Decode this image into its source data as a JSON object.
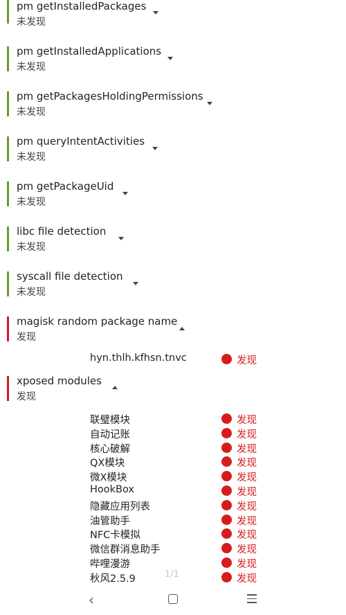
{
  "sections": [
    {
      "title": "pm getInstalledPackages",
      "status": "未发现"
    },
    {
      "title": "pm getInstalledApplications",
      "status": "未发现"
    },
    {
      "title": "pm getPackagesHoldingPermissions",
      "status": "未发现"
    },
    {
      "title": "pm queryIntentActivities",
      "status": "未发现"
    },
    {
      "title": "pm getPackageUid",
      "status": "未发现"
    },
    {
      "title": "libc file detection",
      "status": "未发现"
    },
    {
      "title": "syscall file detection",
      "status": "未发现"
    },
    {
      "title": "magisk random package name",
      "status": "发现"
    },
    {
      "title": "xposed modules",
      "status": "发现"
    }
  ],
  "magisk_items": [
    {
      "name": "hyn.thlh.kfhsn.tnvc",
      "result": "发现"
    }
  ],
  "xposed_items": [
    {
      "name": "联璧模块",
      "result": "发现"
    },
    {
      "name": "自动记账",
      "result": "发现"
    },
    {
      "name": "核心破解",
      "result": "发现"
    },
    {
      "name": "QX模块",
      "result": "发现"
    },
    {
      "name": "微X模块",
      "result": "发现"
    },
    {
      "name": "HookBox",
      "result": "发现"
    },
    {
      "name": "隐藏应用列表",
      "result": "发现"
    },
    {
      "name": "油管助手",
      "result": "发现"
    },
    {
      "name": "NFC卡模拟",
      "result": "发现"
    },
    {
      "name": "微信群消息助手",
      "result": "发现"
    },
    {
      "name": "哔哩漫游",
      "result": "发现"
    },
    {
      "name": "秋风2.5.9",
      "result": "发现"
    }
  ],
  "pager": "1/1",
  "colors": {
    "ok_bar": "#6a9a2a",
    "found_bar": "#d11a2a",
    "found_dot": "#d61c1c"
  },
  "icons": {
    "collapse": "chevron-down-icon",
    "expand": "chevron-up-icon",
    "back": "back-icon",
    "home": "home-icon",
    "menu": "menu-icon"
  }
}
